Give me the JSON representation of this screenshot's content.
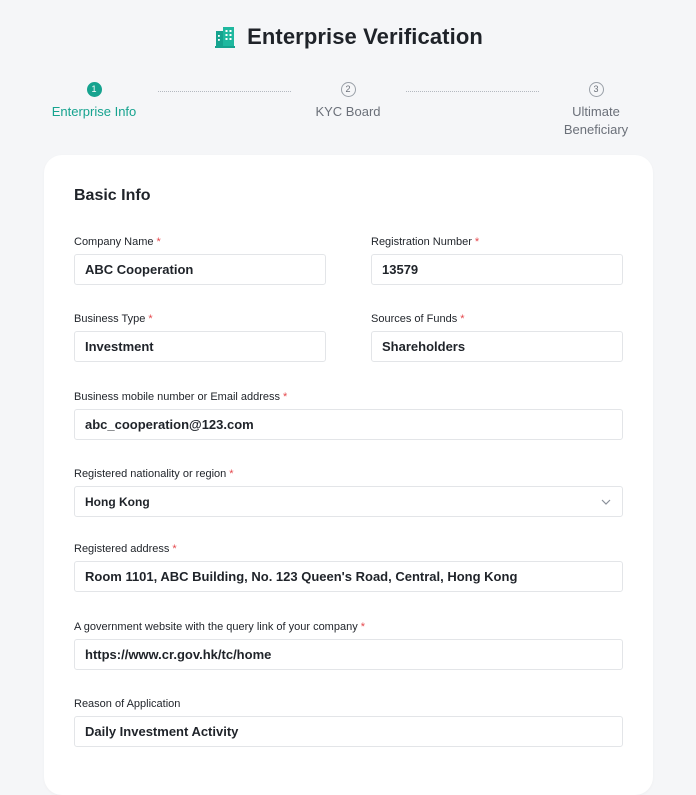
{
  "header": {
    "title": "Enterprise Verification",
    "icon": "building-icon",
    "accent": "#16a38f"
  },
  "steps": [
    {
      "number": "1",
      "label": "Enterprise Info",
      "state": "active"
    },
    {
      "number": "2",
      "label": "KYC Board",
      "state": "inactive"
    },
    {
      "number": "3",
      "label": "Ultimate Beneficiary",
      "state": "inactive"
    }
  ],
  "form": {
    "section_title": "Basic Info",
    "required_mark": "*",
    "company_name": {
      "label": "Company Name",
      "value": "ABC Cooperation"
    },
    "registration_number": {
      "label": "Registration Number",
      "value": "13579"
    },
    "business_type": {
      "label": "Business Type",
      "value": "Investment"
    },
    "sources_of_funds": {
      "label": "Sources of Funds",
      "value": "Shareholders"
    },
    "contact": {
      "label": "Business mobile number or Email address",
      "value": "abc_cooperation@123.com"
    },
    "nationality": {
      "label": "Registered nationality or region",
      "value": "Hong Kong"
    },
    "address": {
      "label": "Registered address",
      "value": "Room 1101, ABC Building, No. 123 Queen's Road, Central, Hong Kong"
    },
    "website": {
      "label": "A government website with the query link of your company",
      "value": "https://www.cr.gov.hk/tc/home"
    },
    "reason": {
      "label": "Reason of Application",
      "value": "Daily Investment Activity"
    }
  }
}
